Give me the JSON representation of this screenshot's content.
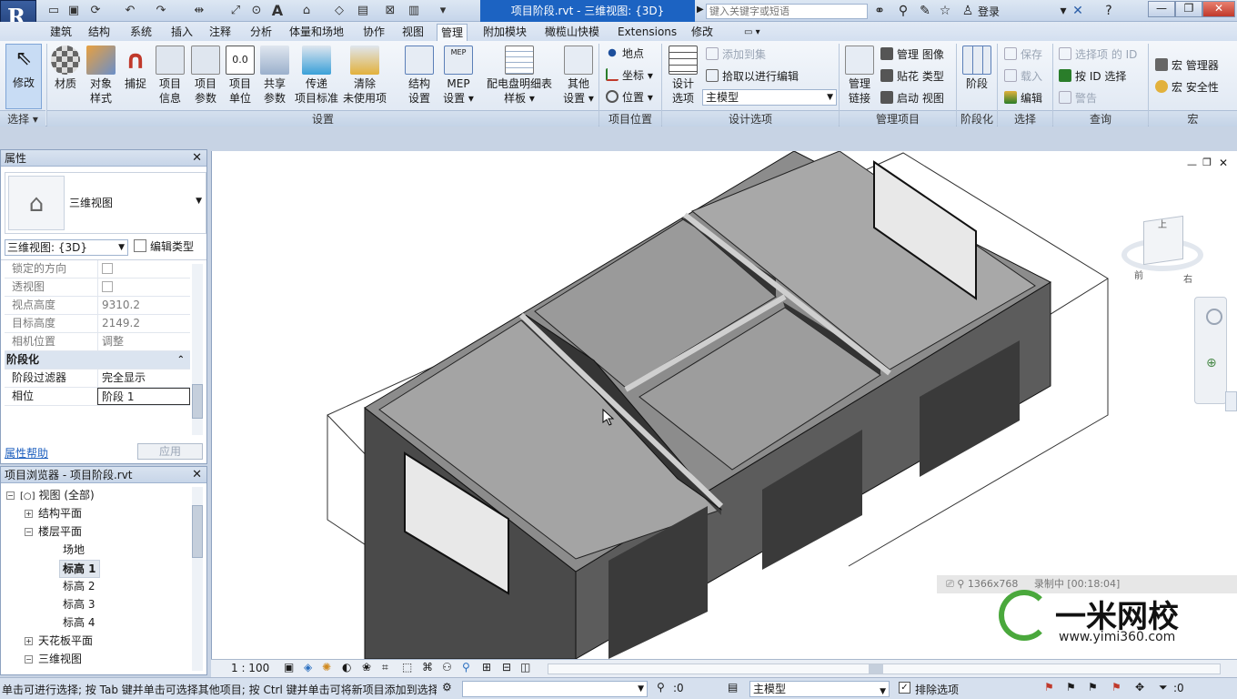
{
  "titlebar": {
    "app_letter": "R",
    "doc_title": "项目阶段.rvt - 三维视图: {3D}",
    "search_placeholder": "键入关键字或短语",
    "login": "登录"
  },
  "tabs": [
    "建筑",
    "结构",
    "系统",
    "插入",
    "注释",
    "分析",
    "体量和场地",
    "协作",
    "视图",
    "管理",
    "附加模块",
    "橄榄山快模",
    "Extensions",
    "修改"
  ],
  "active_tab": "管理",
  "ribbon": {
    "modify": "修改",
    "select_group": "选择",
    "settings": {
      "materials": "材质",
      "object_styles": [
        "对象",
        "样式"
      ],
      "snaps": "捕捉",
      "project_info": [
        "项目",
        "信息"
      ],
      "project_params": [
        "项目",
        "参数"
      ],
      "project_units": [
        "项目",
        "单位"
      ],
      "shared_params": [
        "共享",
        "参数"
      ],
      "transfer_standards": [
        "传递",
        "项目标准"
      ],
      "purge": [
        "清除",
        "未使用项"
      ],
      "structural_settings": [
        "结构",
        "设置"
      ],
      "mep_settings": [
        "MEP",
        "设置"
      ],
      "panel_schedule": [
        "配电盘明细表",
        "样板"
      ],
      "other_settings": [
        "其他",
        "设置"
      ],
      "group": "设置"
    },
    "location": {
      "location": "地点",
      "coordinates": "坐标",
      "position": "位置",
      "group": "项目位置"
    },
    "design_options": {
      "design_options": [
        "设计",
        "选项"
      ],
      "add_to_set": "添加到集",
      "pick_to_edit": "拾取以进行编辑",
      "main_model": "主模型",
      "group": "设计选项"
    },
    "manage_project": {
      "manage_links": [
        "管理",
        "链接"
      ],
      "manage_images": "管理 图像",
      "decal_types": "贴花 类型",
      "starting_view": "启动 视图",
      "group": "管理项目"
    },
    "phasing": {
      "phases": "阶段",
      "group": "阶段化"
    },
    "selection": {
      "save": "保存",
      "load": "载入",
      "edit": "编辑",
      "group": "选择"
    },
    "inquiry": {
      "ids_of_selection": "选择项 的 ID",
      "select_by_id": "按 ID 选择",
      "warnings": "警告",
      "group": "查询"
    },
    "macros": {
      "macro_manager": "宏 管理器",
      "macro_security": "宏 安全性",
      "group": "宏"
    }
  },
  "properties": {
    "title": "属性",
    "type_name": "三维视图",
    "instance_select": "三维视图: {3D}",
    "edit_type": "编辑类型",
    "rows": [
      {
        "k": "锁定的方向",
        "v": ""
      },
      {
        "k": "透视图",
        "v": ""
      },
      {
        "k": "视点高度",
        "v": "9310.2"
      },
      {
        "k": "目标高度",
        "v": "2149.2"
      },
      {
        "k": "相机位置",
        "v": "调整"
      }
    ],
    "section_phasing": "阶段化",
    "phase_filter_k": "阶段过滤器",
    "phase_filter_v": "完全显示",
    "phase_k": "相位",
    "phase_v": "阶段 1",
    "help": "属性帮助",
    "apply": "应用"
  },
  "browser": {
    "title": "项目浏览器 - 项目阶段.rvt",
    "views_all": "视图 (全部)",
    "structural_plans": "结构平面",
    "floor_plans": "楼层平面",
    "site": "场地",
    "level1": "标高 1",
    "level2": "标高 2",
    "level3": "标高 3",
    "level4": "标高 4",
    "ceiling_plans": "天花板平面",
    "views_3d": "三维视图"
  },
  "viewcube": {
    "top": "上",
    "front": "前",
    "right": "右"
  },
  "view_controls": {
    "scale": "1 : 100"
  },
  "watermark": {
    "resolution": "1366x768",
    "recording": "录制中 [00:18:04]",
    "brand": "一米网校",
    "url": "www.yimi360.com"
  },
  "status": {
    "message": "单击可进行选择; 按 Tab 键并单击可选择其他项目; 按 Ctrl 键并单击可将新项目添加到选择",
    "count1": ":0",
    "model": "主模型",
    "exclude_options": "排除选项",
    "count2": ":0"
  }
}
